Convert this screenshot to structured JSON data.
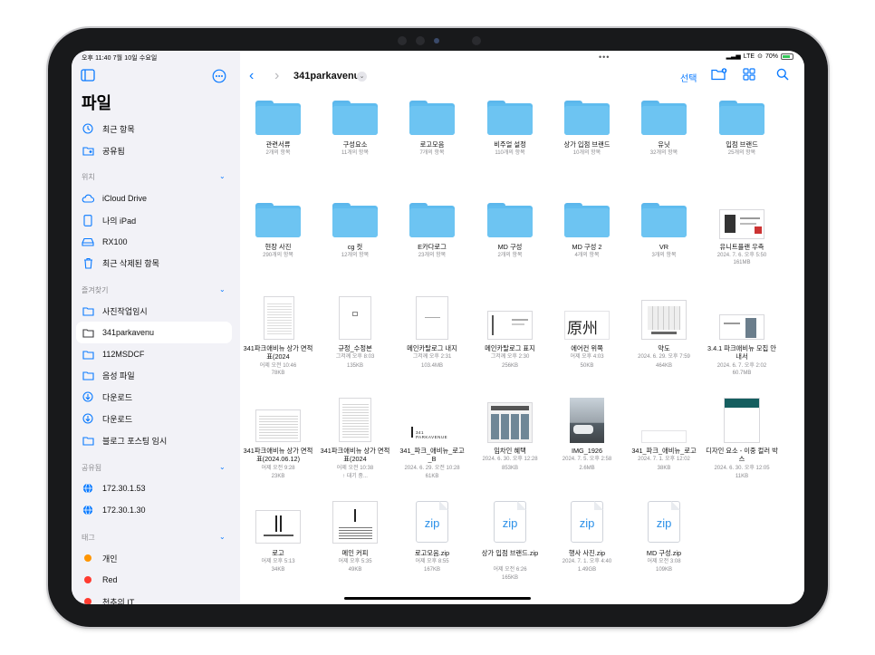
{
  "status": {
    "time": "오후 11:40  7월 10일 수요일",
    "right": "LTE",
    "battery": "70%"
  },
  "sidebar": {
    "title": "파일",
    "quick": [
      {
        "label": "최근 항목",
        "icon": "clock-icon"
      },
      {
        "label": "공유됨",
        "icon": "shared-folder-icon"
      }
    ],
    "locations_header": "위치",
    "locations": [
      {
        "label": "iCloud Drive",
        "icon": "cloud-icon"
      },
      {
        "label": "나의 iPad",
        "icon": "ipad-icon"
      },
      {
        "label": "RX100",
        "icon": "drive-icon"
      },
      {
        "label": "최근 삭제된 항목",
        "icon": "trash-icon"
      }
    ],
    "favorites_header": "즐겨찾기",
    "favorites": [
      {
        "label": "사진작업임시",
        "icon": "folder-icon"
      },
      {
        "label": "341parkavenu",
        "icon": "folder-icon"
      },
      {
        "label": "112MSDCF",
        "icon": "folder-icon"
      },
      {
        "label": "음성 파일",
        "icon": "folder-icon"
      },
      {
        "label": "다운로드",
        "icon": "download-icon"
      },
      {
        "label": "다운로드",
        "icon": "download-icon"
      },
      {
        "label": "블로그 포스팅 임시",
        "icon": "folder-icon"
      }
    ],
    "shared_header": "공유됨",
    "shared": [
      {
        "label": "172.30.1.53",
        "icon": "globe-icon"
      },
      {
        "label": "172.30.1.30",
        "icon": "globe-icon"
      }
    ],
    "tags_header": "태그",
    "tags": [
      {
        "label": "개인",
        "color": "#ff9500"
      },
      {
        "label": "Red",
        "color": "#ff3b30"
      },
      {
        "label": "천추의 IT",
        "color": "#ff3b30"
      }
    ]
  },
  "toolbar": {
    "title": "341parkavenu",
    "select_label": "선택"
  },
  "files": {
    "row1": [
      {
        "name": "관련서류",
        "meta": "2개의 항목"
      },
      {
        "name": "구성요소",
        "meta": "11개의 항목"
      },
      {
        "name": "로고모음",
        "meta": "7개의 항목"
      },
      {
        "name": "비주얼 설정",
        "meta": "110개의 항목"
      },
      {
        "name": "상가 입점 브랜드",
        "meta": "10개의 항목"
      },
      {
        "name": "유닛",
        "meta": "32개의 항목"
      },
      {
        "name": "입점 브랜드",
        "meta": "25개의 항목"
      }
    ],
    "row2": [
      {
        "name": "현장 사진",
        "meta": "290개의 항목"
      },
      {
        "name": "cg 컷",
        "meta": "12개의 항목"
      },
      {
        "name": "E카다로그",
        "meta": "23개의 항목"
      },
      {
        "name": "MD 구성",
        "meta": "2개의 항목"
      },
      {
        "name": "MD 구성 2",
        "meta": "4개의 항목"
      },
      {
        "name": "VR",
        "meta": "3개의 항목"
      },
      {
        "name": "유니트플랜 우측",
        "meta": "2024. 7. 6. 오후 5:50",
        "size": "161MB"
      }
    ],
    "row3": [
      {
        "name": "341파크애비뉴 상가 면적표(2024",
        "meta": "어제 오전 10:46",
        "size": "78KB"
      },
      {
        "name": "규정_수정본",
        "meta": "그저께 오후 8:03",
        "size": "135KB"
      },
      {
        "name": "메인카탈로그 내지",
        "meta": "그저께 오후 2:31",
        "size": "103.4MB"
      },
      {
        "name": "메인카탈로그 표지",
        "meta": "그저께 오후 2:30",
        "size": "256KB"
      },
      {
        "name": "에어컨 위쪽",
        "meta": "어제 오후 4:03",
        "size": "50KB"
      },
      {
        "name": "약도",
        "meta": "2024. 6. 29. 오후 7:59",
        "size": "464KB"
      },
      {
        "name": "3.4.1 파크애비뉴 모집 안내서",
        "meta": "2024. 6. 7. 오후 2:02",
        "size": "60.7MB"
      }
    ],
    "row4": [
      {
        "name": "341파크애비뉴 상가 면적표(2024.06.12)",
        "meta": "어제 오전 9:28",
        "size": "23KB"
      },
      {
        "name": "341파크애비뉴 상가 면적표(2024",
        "meta": "어제 오전 10:38",
        "size": "↑ 대기 중..."
      },
      {
        "name": "341_파크_애비뉴_로고_B",
        "meta": "2024. 6. 29. 오전 10:28",
        "size": "61KB"
      },
      {
        "name": "임차인 혜택",
        "meta": "2024. 6. 30. 오후 12:28",
        "size": "853KB"
      },
      {
        "name": "IMG_1926",
        "meta": "2024. 7. 5. 오후 2:58",
        "size": "2.6MB"
      },
      {
        "name": "341_파크_애비뉴_로고",
        "meta": "2024. 7. 1. 오후 12:02",
        "size": "38KB"
      },
      {
        "name": "디자인 요소 - 이중 컬러 박스",
        "meta": "2024. 6. 30. 오후 12:05",
        "size": "11KB"
      }
    ],
    "row5": [
      {
        "name": "로고",
        "meta": "어제 오후 5:13",
        "size": "34KB"
      },
      {
        "name": "메인 커피",
        "meta": "어제 오후 5:35",
        "size": "49KB"
      },
      {
        "name": "로고모음.zip",
        "meta": "어제 오후 8:55",
        "size": "167KB",
        "zip": "zip"
      },
      {
        "name": "상가 입점 브랜드.zip",
        "meta": "어제 오전 6:26",
        "size": "165KB",
        "zip": "zip"
      },
      {
        "name": "행사 사진.zip",
        "meta": "2024. 7. 1. 오후 4:40",
        "size": "1.49GB",
        "zip": "zip"
      },
      {
        "name": "MD 구성.zip",
        "meta": "어제 오전 3:08",
        "size": "109KB",
        "zip": "zip"
      }
    ]
  },
  "thumb_text": {
    "kanji": "原州",
    "logo_tag": "341 PARKAVENUE"
  }
}
